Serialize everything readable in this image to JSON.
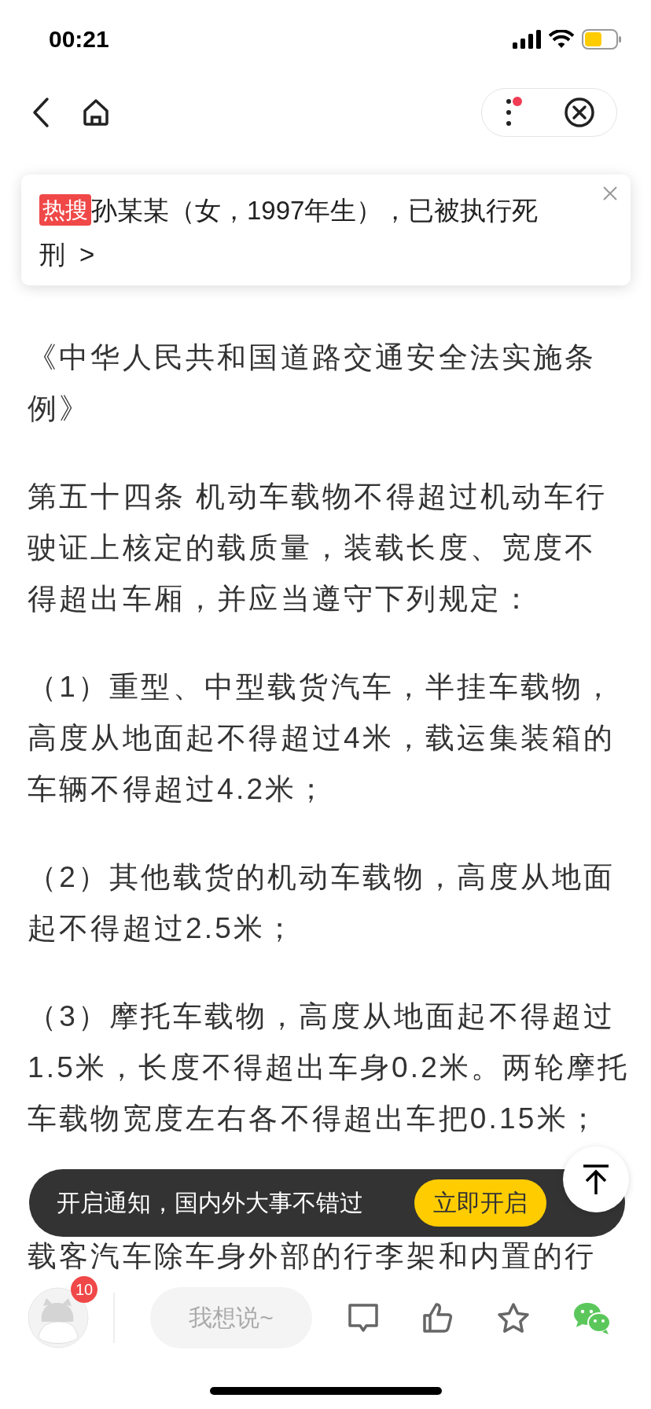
{
  "status_bar": {
    "time": "00:21"
  },
  "hot_card": {
    "badge": "热搜",
    "title_lines": [
      "孙某某（女，1997年生），已被执行死",
      "刑"
    ],
    "arrow": ">"
  },
  "article": {
    "paragraphs": [
      {
        "lines": [
          "《中华人民共和国道路交通安全法实施条",
          "例》"
        ]
      },
      {
        "lines": [
          "第五十四条 机动车载物不得超过机动车行",
          "驶证上核定的载质量，装载长度、宽度不",
          "得超出车厢，并应当遵守下列规定："
        ]
      },
      {
        "lines": [
          "（1）重型、中型载货汽车，半挂车载物，",
          "高度从地面起不得超过4米，载运集装箱的",
          "车辆不得超过4.2米；"
        ]
      },
      {
        "lines": [
          "（2）其他载货的机动车载物，高度从地面",
          "起不得超过2.5米；"
        ]
      },
      {
        "lines": [
          "（3）摩托车载物，高度从地面起不得超过",
          "1.5米，长度不得超出车身0.2米。两轮摩托",
          "车载物宽度左右各不得超出车把0.15米；"
        ]
      },
      {
        "lines": [
          "载客汽车除车身外部的行李架和内置的行"
        ]
      }
    ]
  },
  "toast": {
    "text": "开启通知，国内外大事不错过",
    "button": "立即开启"
  },
  "bottom_bar": {
    "badge": "10",
    "placeholder": "我想说~"
  }
}
